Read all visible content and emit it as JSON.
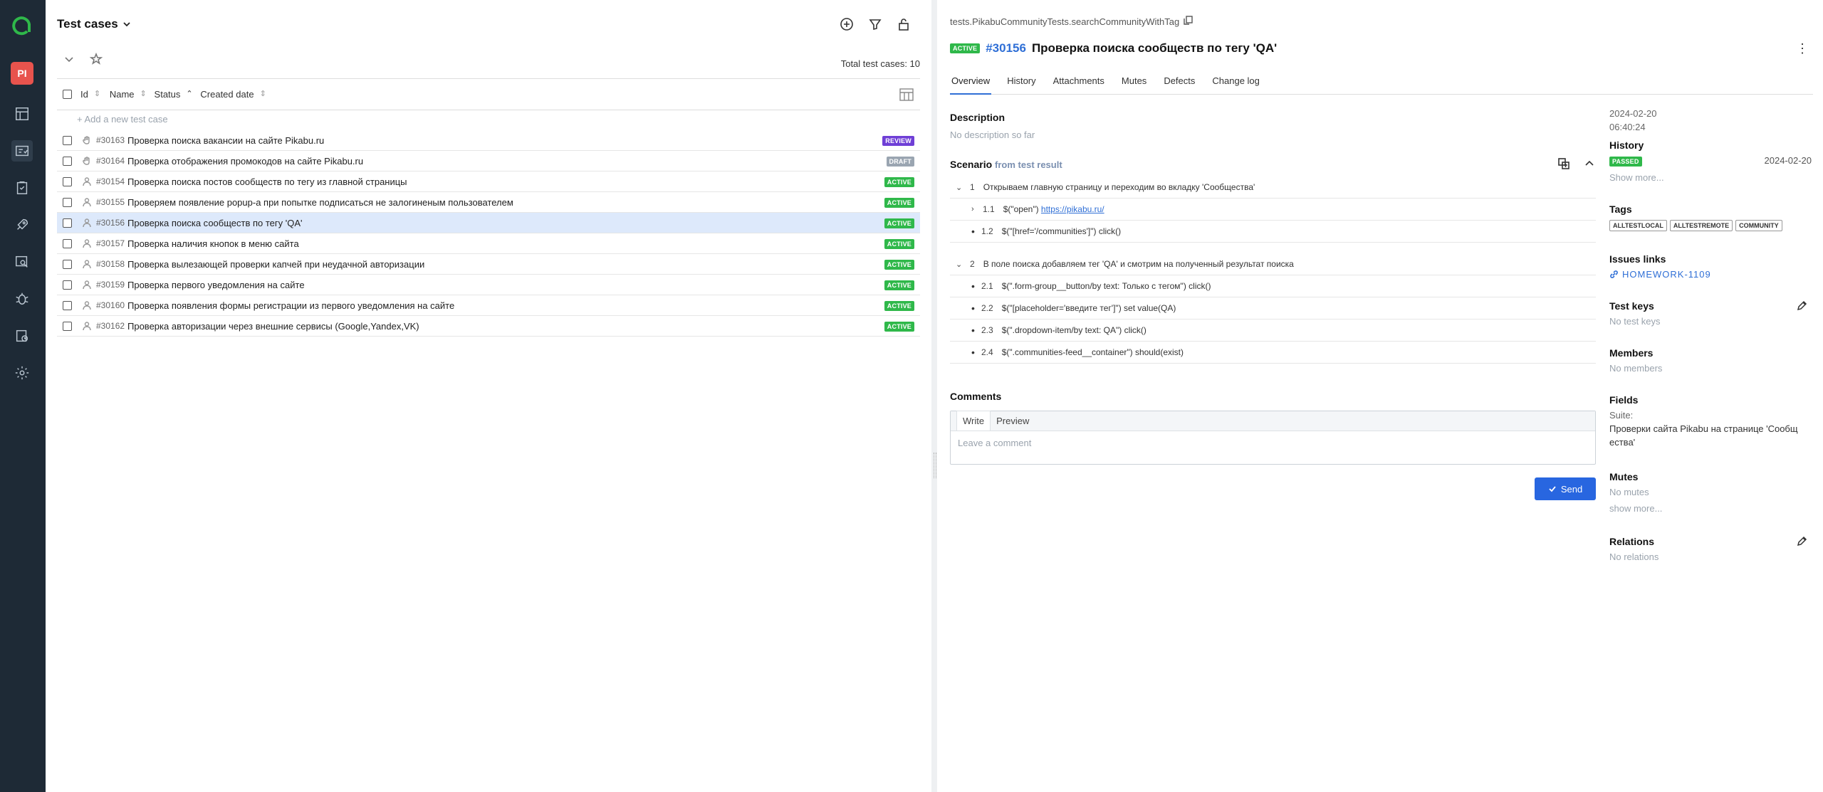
{
  "left": {
    "title": "Test cases",
    "total": "Total test cases: 10",
    "add_row": "+ Add a new test case",
    "columns": [
      "Id",
      "Name",
      "Status",
      "Created date"
    ],
    "rows": [
      {
        "id": "#30163",
        "name": "Проверка поиска вакансии на сайте Pikabu.ru",
        "status": "REVIEW"
      },
      {
        "id": "#30164",
        "name": "Проверка отображения промокодов на сайте Pikabu.ru",
        "status": "DRAFT"
      },
      {
        "id": "#30154",
        "name": "Проверка поиска постов сообществ по тегу из главной страницы",
        "status": "ACTIVE"
      },
      {
        "id": "#30155",
        "name": "Проверяем появление popup-а при попытке подписаться не залогиненым пользователем",
        "status": "ACTIVE"
      },
      {
        "id": "#30156",
        "name": "Проверка поиска сообществ по тегу 'QA'",
        "status": "ACTIVE"
      },
      {
        "id": "#30157",
        "name": "Проверка наличия кнопок в меню сайта",
        "status": "ACTIVE"
      },
      {
        "id": "#30158",
        "name": "Проверка вылезающей проверки капчей при неудачной авторизации",
        "status": "ACTIVE"
      },
      {
        "id": "#30159",
        "name": "Проверка первого уведомления на сайте",
        "status": "ACTIVE"
      },
      {
        "id": "#30160",
        "name": "Проверка появления формы регистрации из первого уведомления на сайте",
        "status": "ACTIVE"
      },
      {
        "id": "#30162",
        "name": "Проверка авторизации через внешние сервисы (Google,Yandex,VK)",
        "status": "ACTIVE"
      }
    ]
  },
  "nav": {
    "project_initials": "PI"
  },
  "right": {
    "path": "tests.PikabuCommunityTests.searchCommunityWithTag",
    "status": "ACTIVE",
    "id": "#30156",
    "title": "Проверка поиска сообществ по тегу 'QA'",
    "kebab": "⋮",
    "tabs": [
      "Overview",
      "History",
      "Attachments",
      "Mutes",
      "Defects",
      "Change log"
    ],
    "description_label": "Description",
    "description_value": "No description so far",
    "scenario_label": "Scenario",
    "scenario_from": "from test result",
    "steps": {
      "s1_num": "1",
      "s1_text": "Открываем главную страницу и переходим во вкладку 'Сообщества'",
      "s11_num": "1.1",
      "s11_prefix": "$(\"open\")",
      "s11_link": "https://pikabu.ru/",
      "s12_num": "1.2",
      "s12_text": "$(\"[href='/communities']\") click()",
      "s2_num": "2",
      "s2_text": "В поле поиска добавляем тег 'QA' и смотрим на полученный результат поиска",
      "s21_num": "2.1",
      "s21_text": "$(\".form-group__button/by text: Только с тегом\") click()",
      "s22_num": "2.2",
      "s22_text": "$(\"[placeholder='введите тег']\") set value(QA)",
      "s23_num": "2.3",
      "s23_text": "$(\".dropdown-item/by text: QA\") click()",
      "s24_num": "2.4",
      "s24_text": "$(\".communities-feed__container\") should(exist)"
    },
    "comments_label": "Comments",
    "comment_tabs": [
      "Write",
      "Preview"
    ],
    "comment_placeholder": "Leave a comment",
    "send_label": "Send",
    "side": {
      "date": "2024-02-20",
      "time": "06:40:24",
      "history_label": "History",
      "history_status": "PASSED",
      "history_date": "2024-02-20",
      "show_more": "Show more...",
      "tags_label": "Tags",
      "tags": [
        "ALLTESTLOCAL",
        "ALLTESTREMOTE",
        "COMMUNITY"
      ],
      "issues_label": "Issues links",
      "issue": "HOMEWORK-1109",
      "keys_label": "Test keys",
      "keys_value": "No test keys",
      "members_label": "Members",
      "members_value": "No members",
      "fields_label": "Fields",
      "suite_label": "Suite:",
      "suite_value": "Проверки сайта Pikabu на странице 'Сообщ ества'",
      "mutes_label": "Mutes",
      "mutes_value": "No mutes",
      "mutes_more": "show more...",
      "relations_label": "Relations",
      "relations_value": "No relations"
    }
  },
  "colors": {
    "accent": "#2f6fd6",
    "active": "#2fb84a",
    "review": "#6f3fd6",
    "draft": "#9aa5b1",
    "nav": "#1e2a36"
  }
}
